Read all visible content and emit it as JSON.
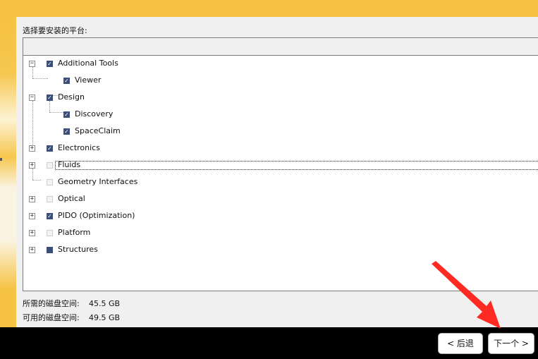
{
  "section_label": "选择要安装的平台:",
  "tree_items": [
    {
      "label": "Additional Tools",
      "state": "checked",
      "toggle": "⊟",
      "icon": "minus-box-icon"
    },
    {
      "label": "Viewer",
      "state": "checked",
      "child": true
    },
    {
      "label": "Design",
      "state": "checked",
      "toggle": "⊟",
      "icon": "minus-box-icon"
    },
    {
      "label": "Discovery",
      "state": "checked",
      "child": true
    },
    {
      "label": "SpaceClaim",
      "state": "checked",
      "child": true
    },
    {
      "label": "Electronics",
      "state": "checked",
      "toggle": "⊞",
      "icon": "plus-box-icon"
    },
    {
      "label": "Fluids",
      "state": "unchecked",
      "toggle": "⊞",
      "icon": "plus-box-icon",
      "focused": true
    },
    {
      "label": "Geometry Interfaces",
      "state": "unchecked"
    },
    {
      "label": "Optical",
      "state": "unchecked",
      "toggle": "⊞",
      "icon": "plus-box-icon"
    },
    {
      "label": "PIDO (Optimization)",
      "state": "checked",
      "toggle": "⊞",
      "icon": "plus-box-icon"
    },
    {
      "label": "Platform",
      "state": "unchecked",
      "toggle": "⊞",
      "icon": "plus-box-icon"
    },
    {
      "label": "Structures",
      "state": "partial",
      "toggle": "⊞",
      "icon": "plus-box-icon"
    }
  ],
  "disk": {
    "required_label": "所需的磁盘空间:",
    "required_value": "45.5 GB",
    "available_label": "可用的磁盘空间:",
    "available_value": "49.5 GB"
  },
  "buttons": {
    "back": "< 后退",
    "next": "下一个 >"
  },
  "colors": {
    "accent_yellow": "#f6c243",
    "checkbox_fill": "#3c4d77",
    "annotation_arrow": "#ff2b22"
  }
}
